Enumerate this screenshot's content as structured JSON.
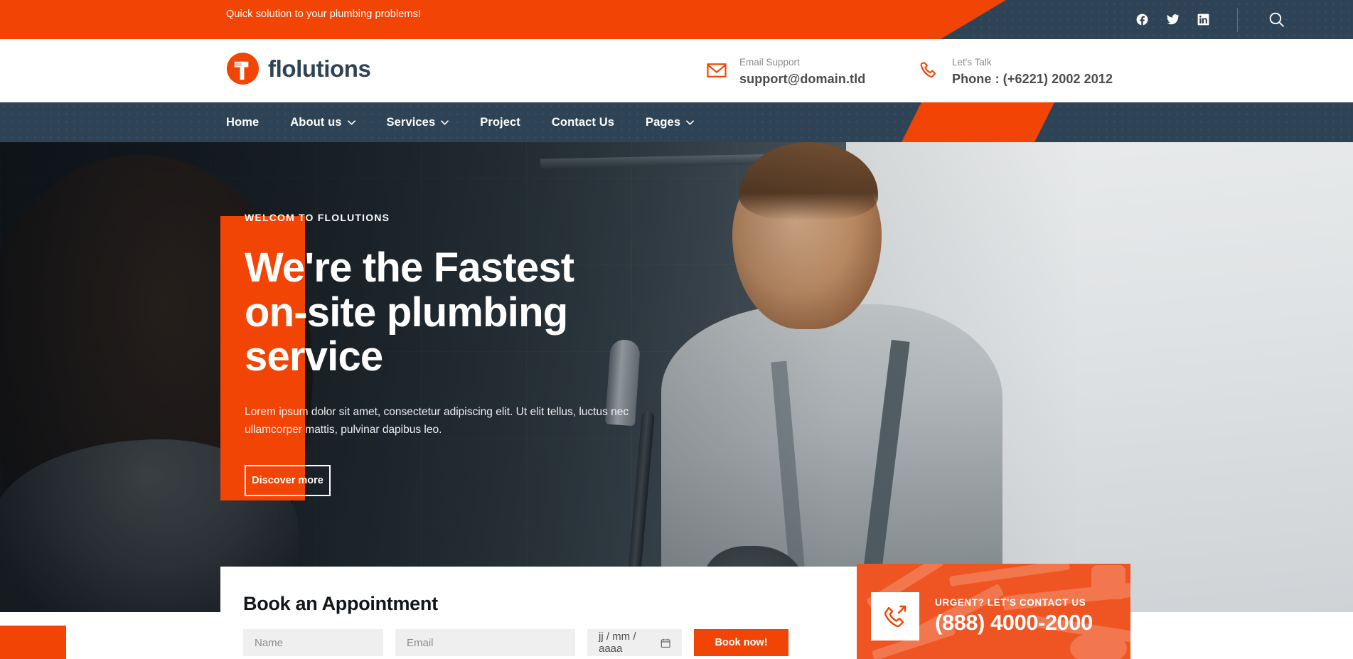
{
  "brand": {
    "name": "flolutions",
    "accent_color": "#f24405",
    "dark_color": "#2f4356"
  },
  "topbar": {
    "tagline": "Quick solution to your plumbing problems!",
    "social": [
      {
        "name": "facebook-icon",
        "label": "Facebook"
      },
      {
        "name": "twitter-icon",
        "label": "Twitter"
      },
      {
        "name": "linkedin-icon",
        "label": "LinkedIn"
      }
    ],
    "search_label": "Search"
  },
  "header": {
    "email": {
      "label": "Email Support",
      "value": "support@domain.tld",
      "icon": "envelope-icon"
    },
    "phone": {
      "label": "Let's Talk",
      "value": "Phone : (+6221) 2002 2012",
      "icon": "phone-icon"
    }
  },
  "nav": {
    "items": [
      {
        "label": "Home",
        "has_dropdown": false
      },
      {
        "label": "About us",
        "has_dropdown": true
      },
      {
        "label": "Services",
        "has_dropdown": true
      },
      {
        "label": "Project",
        "has_dropdown": false
      },
      {
        "label": "Contact Us",
        "has_dropdown": false
      },
      {
        "label": "Pages",
        "has_dropdown": true
      }
    ]
  },
  "hero": {
    "kicker": "WELCOM TO FLOLUTIONS",
    "title": "We're the Fastest on-site plumbing service",
    "description": "Lorem ipsum dolor sit amet, consectetur adipiscing elit. Ut elit tellus, luctus nec ullamcorper mattis, pulvinar dapibus leo.",
    "button": "Discover more"
  },
  "booking": {
    "title": "Book an Appointment",
    "name_placeholder": "Name",
    "email_placeholder": "Email",
    "date_value": "jj / mm / aaaa",
    "submit_label": "Book now!"
  },
  "urgent": {
    "label": "URGENT? LET'S CONTACT US",
    "number": "(888) 4000-2000",
    "icon": "phone-outgoing-icon"
  }
}
